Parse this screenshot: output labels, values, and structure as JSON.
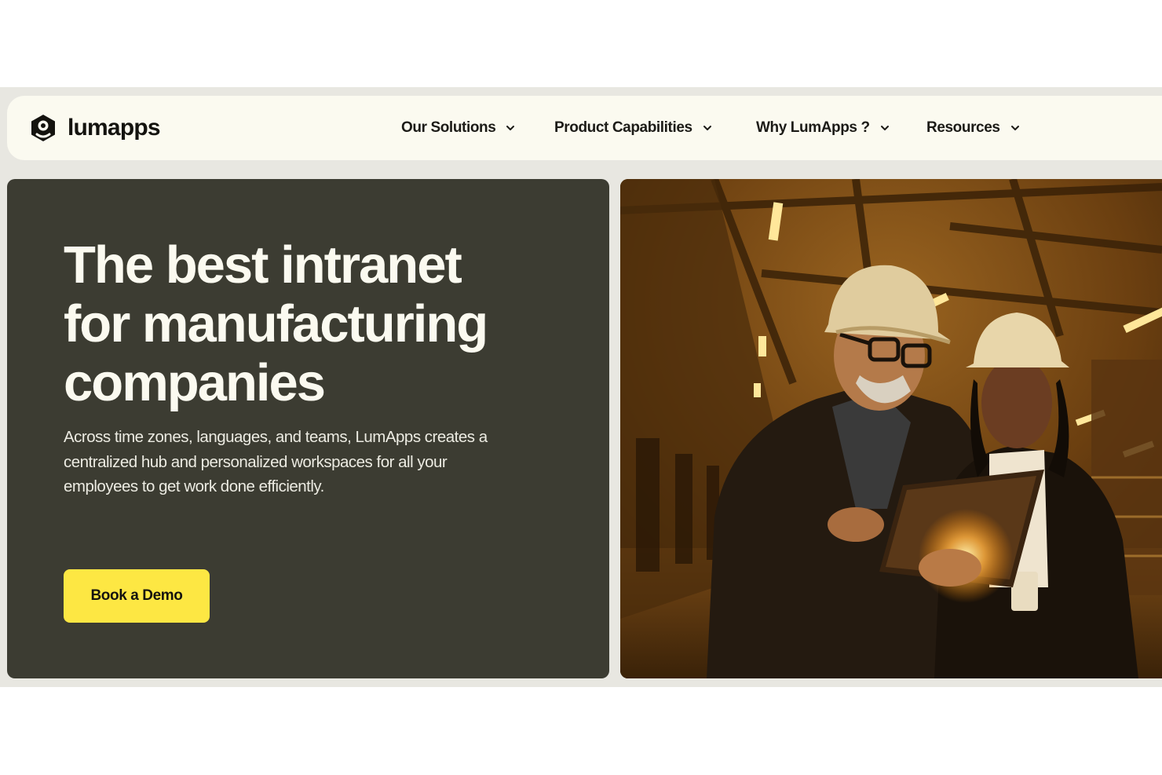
{
  "brand": {
    "name": "lumapps",
    "logo_icon": "lumapps-hexagon-logo-icon"
  },
  "nav": {
    "items": [
      {
        "label": "Our Solutions",
        "icon": "chevron-down-icon"
      },
      {
        "label": "Product Capabilities",
        "icon": "chevron-down-icon"
      },
      {
        "label": "Why LumApps ?",
        "icon": "chevron-down-icon"
      },
      {
        "label": "Resources",
        "icon": "chevron-down-icon"
      }
    ]
  },
  "hero": {
    "title_lines": [
      "The best intranet",
      "for manufacturing",
      "companies"
    ],
    "description_lines": [
      "Across time zones, languages, and teams, LumApps creates a",
      "centralized hub and personalized workspaces for all your",
      "employees to get work done efficiently."
    ],
    "cta_label": "Book a Demo",
    "image_subject": "two-engineers-with-hard-hats-and-laptop-in-factory"
  },
  "colors": {
    "page_background": "#ffffff",
    "band_background": "#e8e7e1",
    "navbar_background": "#fbfaf0",
    "hero_background": "#3c3c32",
    "hero_text": "#fbfaf0",
    "cta_background": "#fde743",
    "text_dark": "#14130f",
    "photo_tone": "#8a5418"
  }
}
